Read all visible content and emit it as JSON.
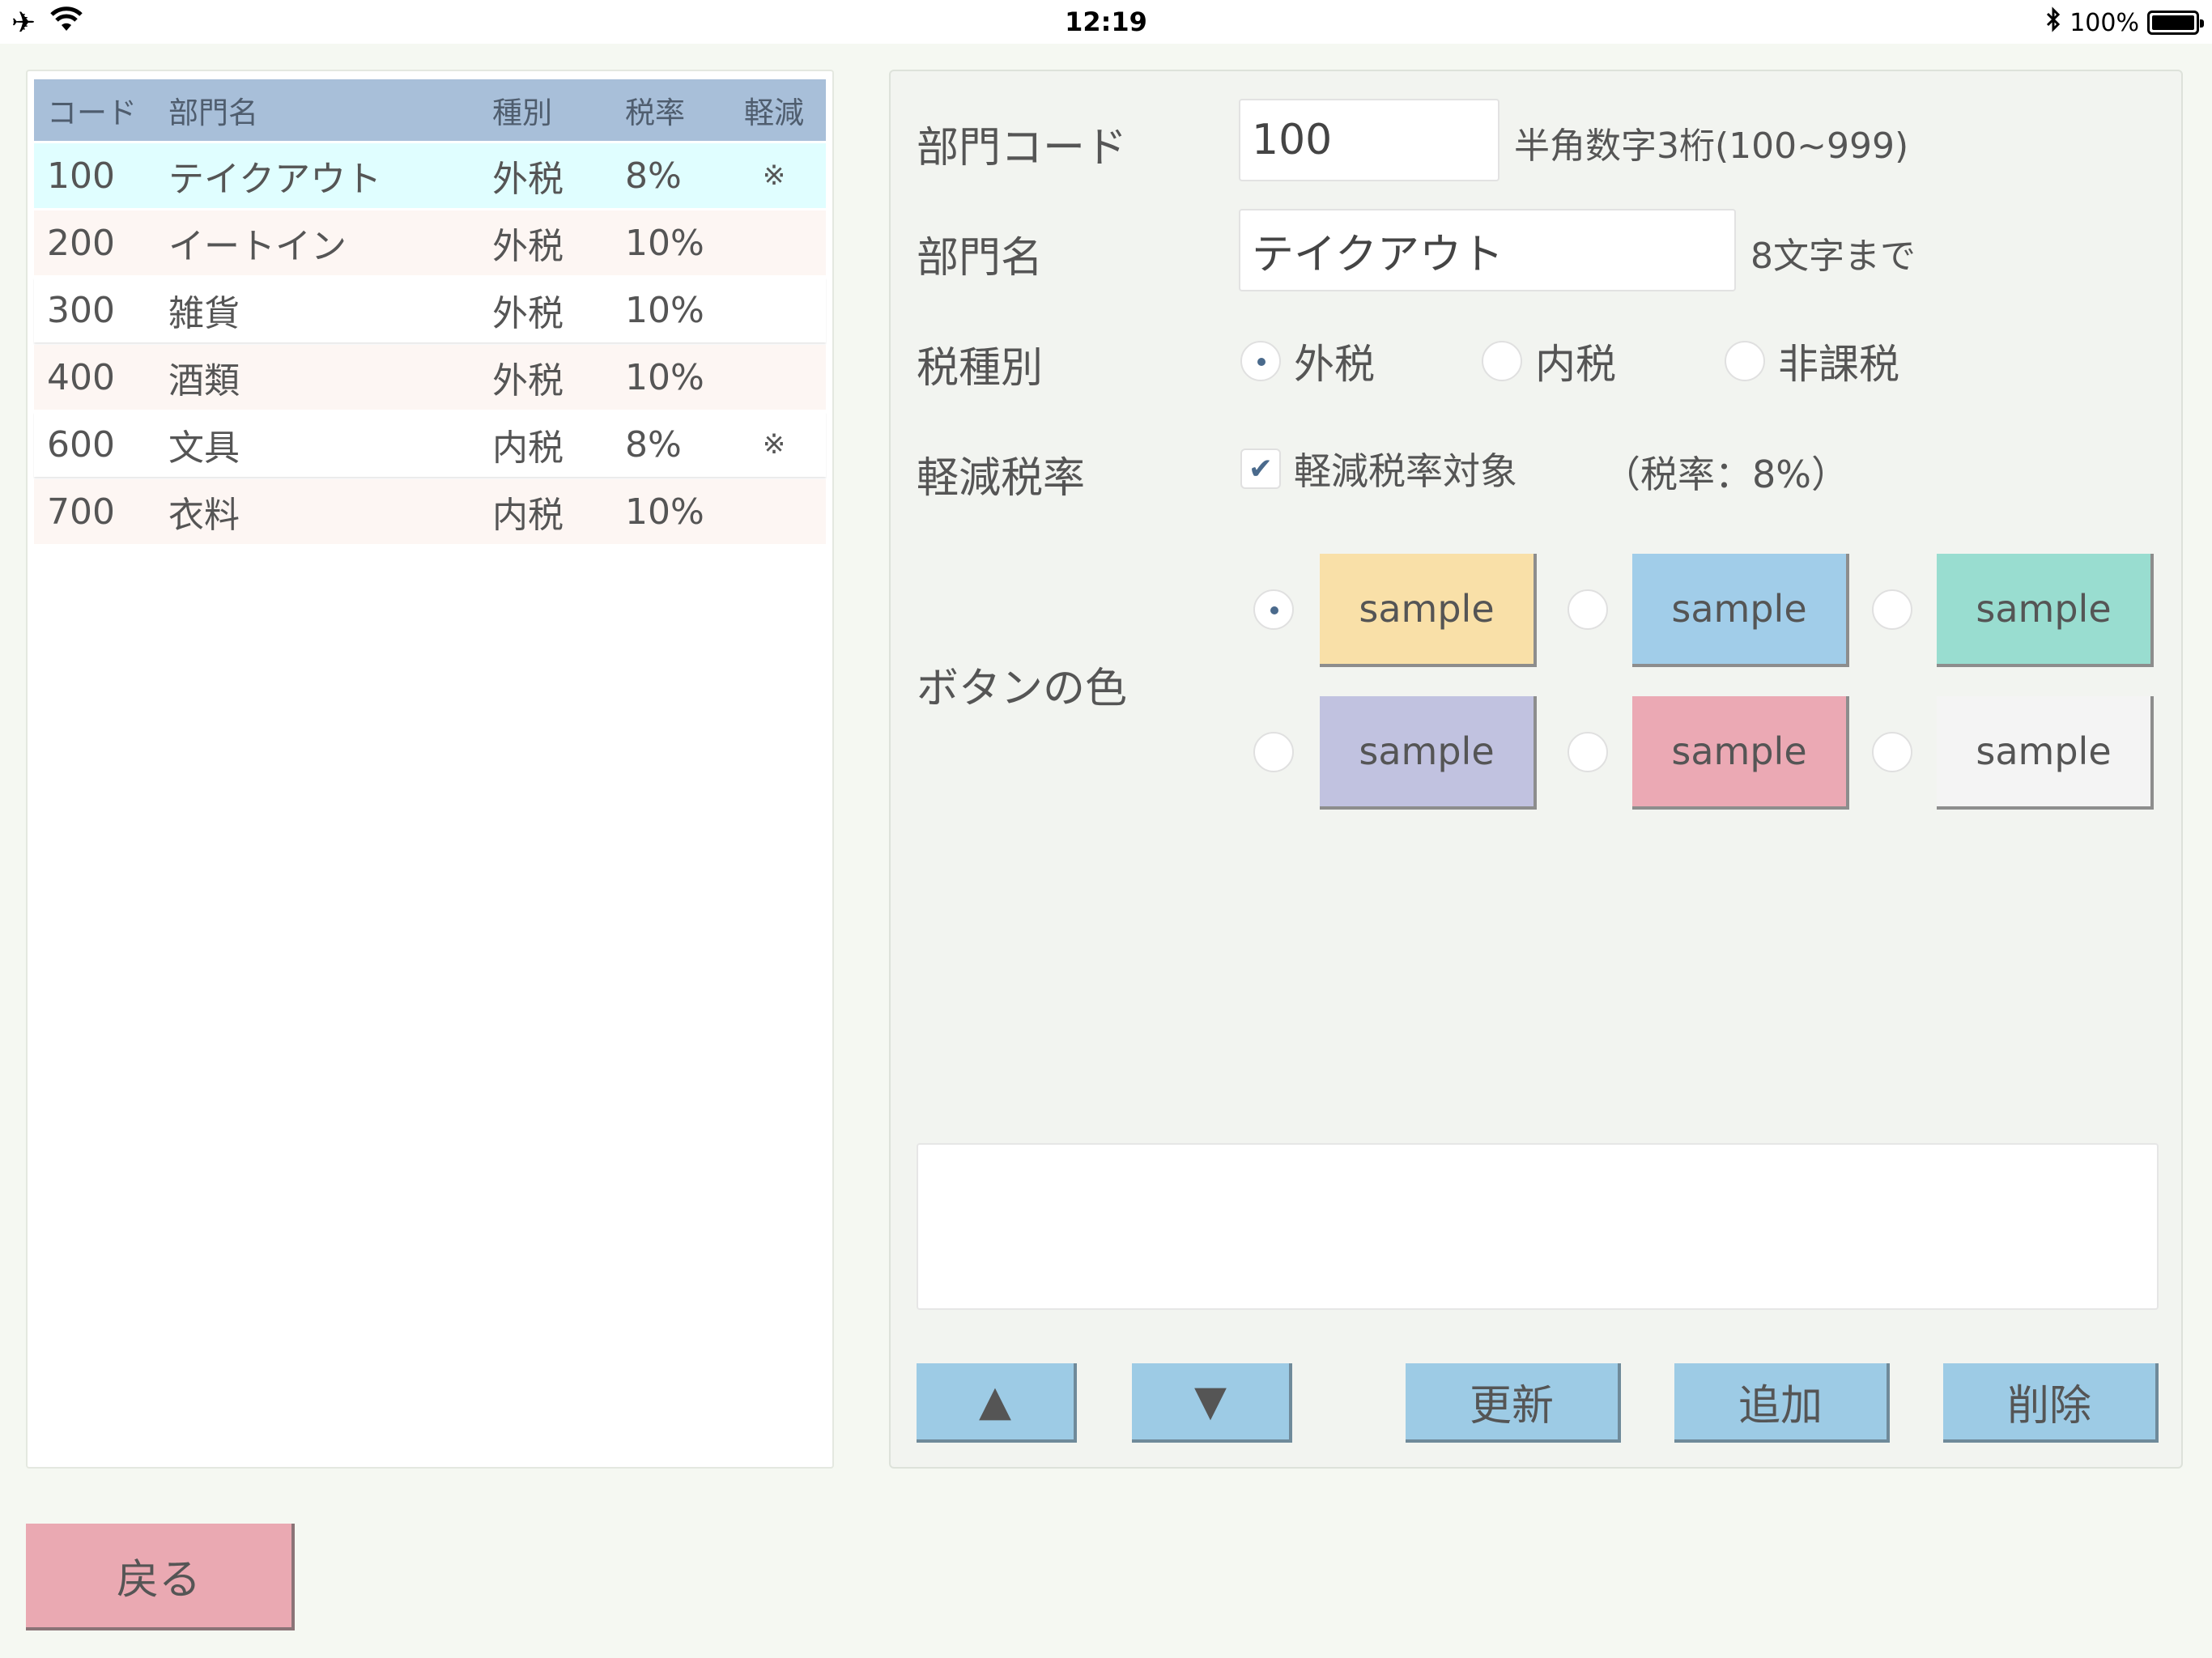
{
  "status_bar": {
    "airplane_icon": "airplane-icon",
    "wifi_icon": "wifi-icon",
    "time": "12:19",
    "bluetooth_icon": "bluetooth-icon",
    "battery": "100%"
  },
  "list": {
    "headers": {
      "code": "コード",
      "name": "部門名",
      "type": "種別",
      "rate": "税率",
      "reduced": "軽減"
    },
    "rows": [
      {
        "code": "100",
        "name": "テイクアウト",
        "type": "外税",
        "rate": "8%",
        "reduced": "※"
      },
      {
        "code": "200",
        "name": "イートイン",
        "type": "外税",
        "rate": "10%",
        "reduced": ""
      },
      {
        "code": "300",
        "name": "雑貨",
        "type": "外税",
        "rate": "10%",
        "reduced": ""
      },
      {
        "code": "400",
        "name": "酒類",
        "type": "外税",
        "rate": "10%",
        "reduced": ""
      },
      {
        "code": "600",
        "name": "文具",
        "type": "内税",
        "rate": "8%",
        "reduced": "※"
      },
      {
        "code": "700",
        "name": "衣料",
        "type": "内税",
        "rate": "10%",
        "reduced": ""
      }
    ]
  },
  "form": {
    "code_label": "部門コード",
    "code_value": "100",
    "code_hint": "半角数字3桁(100~999)",
    "name_label": "部門名",
    "name_value": "テイクアウト",
    "name_hint": "8文字まで",
    "tax_label": "税種別",
    "tax_options": [
      "外税",
      "内税",
      "非課税"
    ],
    "tax_selected": "外税",
    "reduced_label": "軽減税率",
    "reduced_check_label": "軽減税率対象",
    "reduced_checked": true,
    "reduced_rate_text": "（税率：8%）",
    "color_label": "ボタンの色",
    "colors": [
      {
        "label": "sample",
        "color": "#f9e0a8",
        "selected": true
      },
      {
        "label": "sample",
        "color": "#a1cde9",
        "selected": false
      },
      {
        "label": "sample",
        "color": "#99ddd0",
        "selected": false
      },
      {
        "label": "sample",
        "color": "#c1c2e0",
        "selected": false
      },
      {
        "label": "sample",
        "color": "#eba9b4",
        "selected": false
      },
      {
        "label": "sample",
        "color": "#f4f4f4",
        "selected": false
      }
    ],
    "memo": ""
  },
  "buttons": {
    "up": "▲",
    "down": "▼",
    "update": "更新",
    "add": "追加",
    "delete": "削除",
    "back": "戻る"
  }
}
